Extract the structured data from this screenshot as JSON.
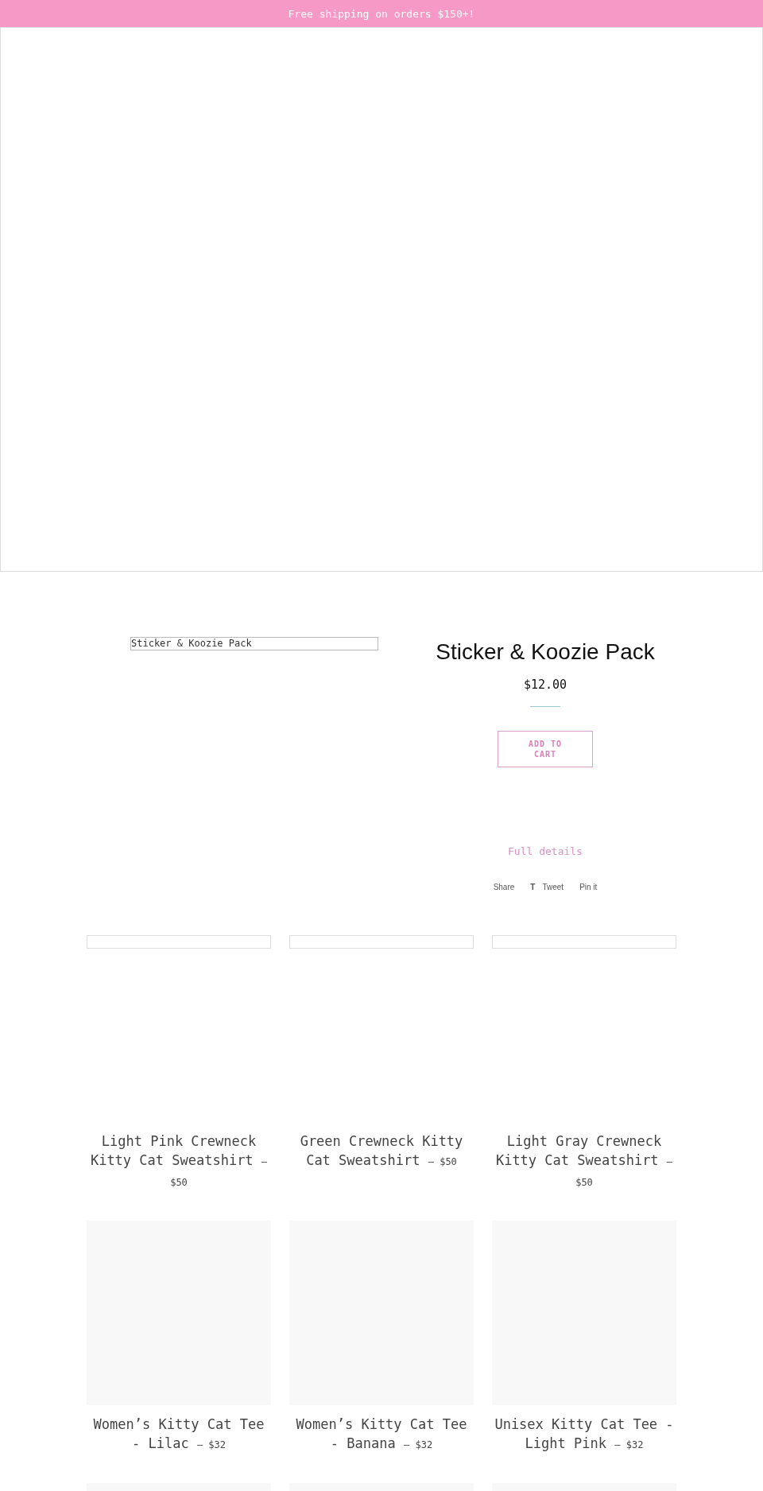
{
  "announcement": {
    "text": "Free shipping on orders $150+!"
  },
  "hero": {
    "kind": "broken"
  },
  "product": {
    "image_alt": "Sticker & Koozie Pack",
    "title": "Sticker & Koozie Pack",
    "price": "$12.00",
    "add_to_cart": "ADD TO CART",
    "full_details": "Full details",
    "share": [
      {
        "kind": "plain",
        "label": "Share"
      },
      {
        "kind": "tweet",
        "icon": "T",
        "label": "Tweet"
      },
      {
        "kind": "plain",
        "label": "Pin it"
      }
    ]
  },
  "products": [
    {
      "kind": "broken",
      "title": "Light Pink Crewneck Kitty Cat Sweatshirt",
      "dash": "—",
      "price": "$50"
    },
    {
      "kind": "broken",
      "title": "Green Crewneck Kitty Cat Sweatshirt",
      "dash": "—",
      "price": "$50"
    },
    {
      "kind": "broken",
      "title": "Light Gray Crewneck Kitty Cat Sweatshirt",
      "dash": "—",
      "price": "$50"
    },
    {
      "kind": "placeholder",
      "title": "Women’s Kitty Cat Tee - Lilac",
      "dash": "—",
      "price": "$32"
    },
    {
      "kind": "placeholder",
      "title": "Women’s Kitty Cat Tee - Banana",
      "dash": "—",
      "price": "$32"
    },
    {
      "kind": "placeholder",
      "title": "Unisex Kitty Cat Tee - Light Pink",
      "dash": "—",
      "price": "$32"
    },
    {
      "kind": "placeholder"
    },
    {
      "kind": "placeholder"
    },
    {
      "kind": "placeholder"
    }
  ]
}
